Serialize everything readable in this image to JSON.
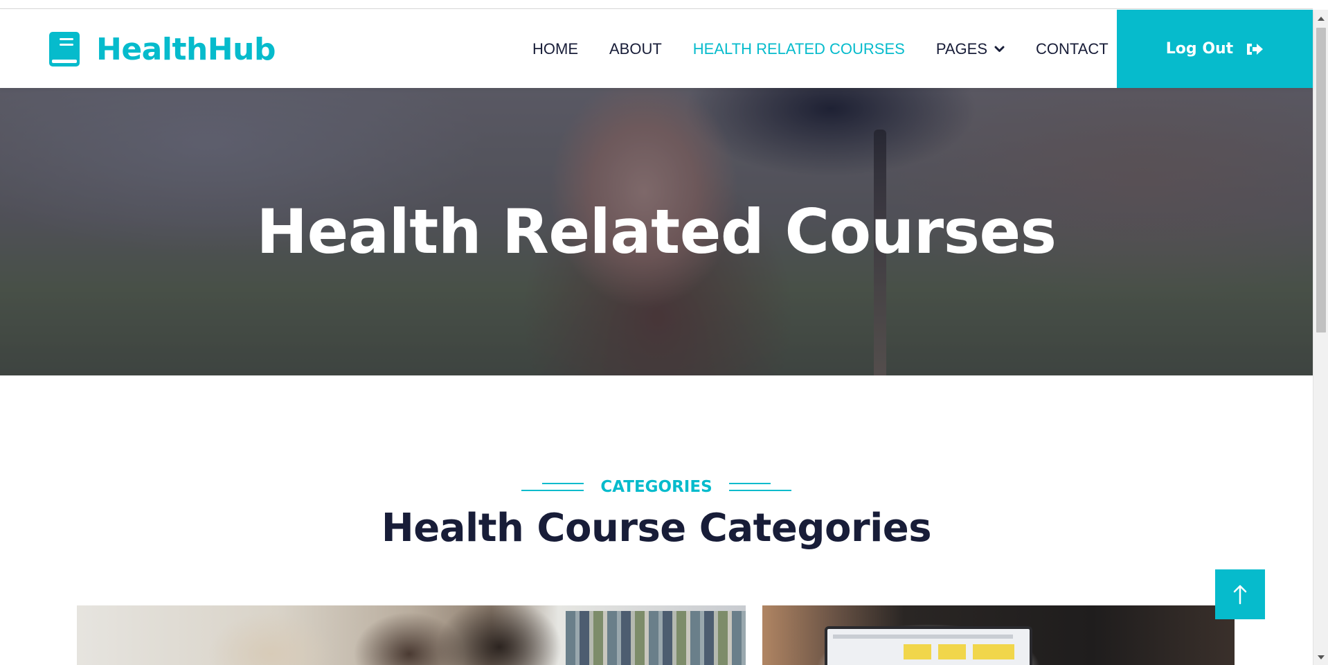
{
  "brand": {
    "name": "HealthHub",
    "icon": "book-icon",
    "color": "#06bbcc"
  },
  "nav": {
    "items": [
      {
        "label": "HOME",
        "active": false
      },
      {
        "label": "ABOUT",
        "active": false
      },
      {
        "label": "HEALTH RELATED COURSES",
        "active": true
      },
      {
        "label": "PAGES",
        "active": false,
        "dropdown": true,
        "icon": "chevron-down-icon"
      },
      {
        "label": "CONTACT",
        "active": false
      }
    ],
    "logout_label": "Log Out",
    "logout_icon": "sign-out-icon"
  },
  "hero": {
    "title": "Health Related Courses"
  },
  "categories": {
    "label": "CATEGORIES",
    "title": "Health Course Categories"
  },
  "back_to_top_icon": "arrow-up-icon",
  "colors": {
    "accent": "#06bbcc",
    "dark": "#181d38"
  }
}
